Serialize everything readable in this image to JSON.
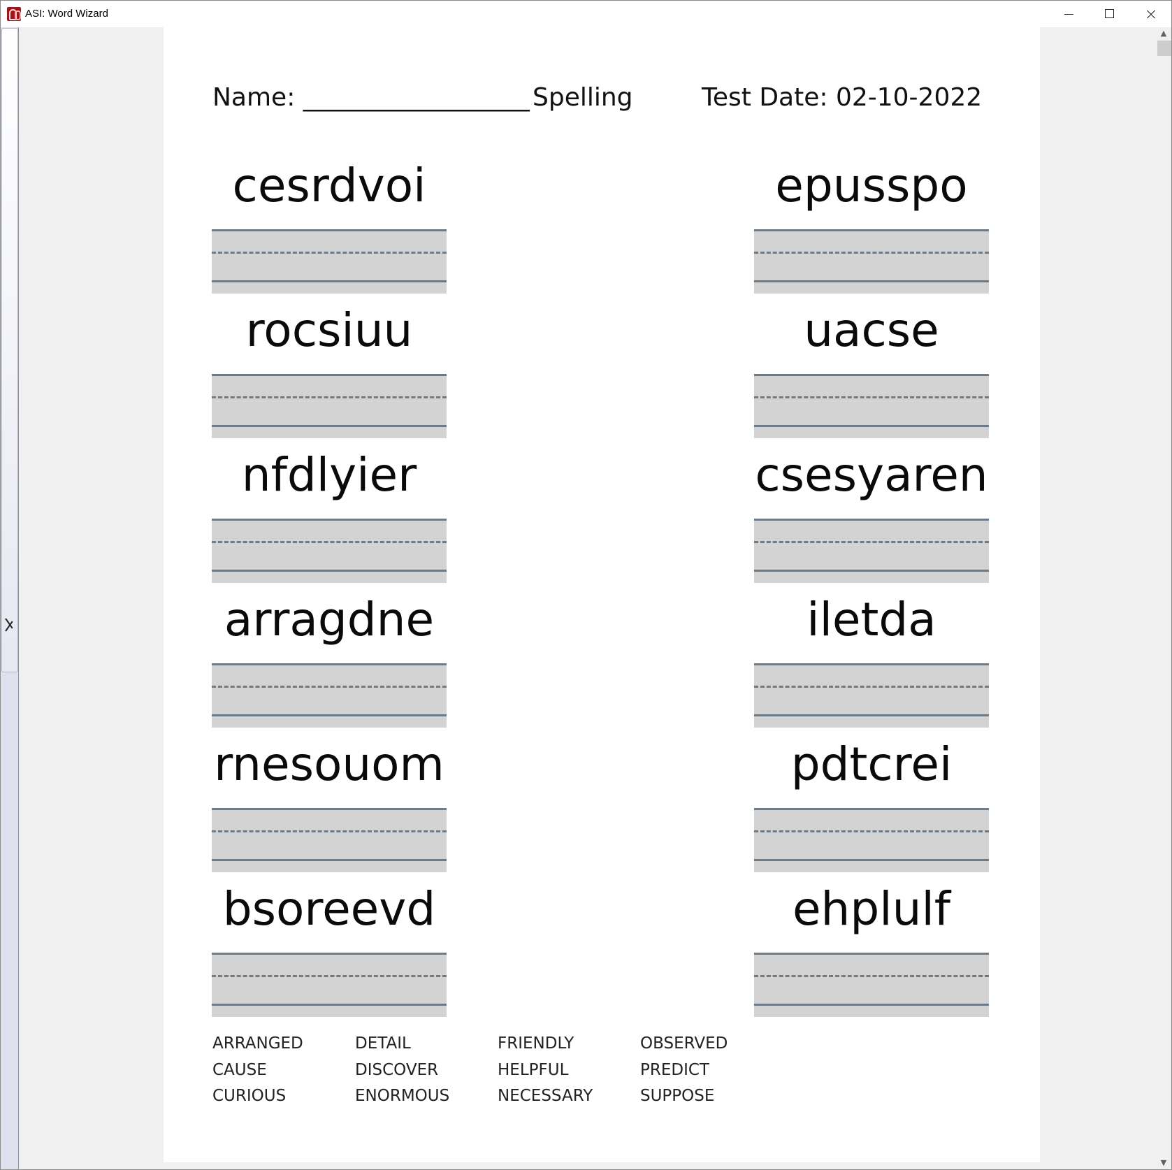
{
  "window": {
    "title": "ASI: Word Wizard",
    "controls": [
      "minimize",
      "maximize",
      "close"
    ]
  },
  "worksheet": {
    "name_label": "Name: __________________",
    "subject": "Spelling",
    "test_date": "Test Date: 02-10-2022",
    "left_words": [
      "cesrdvoi",
      "rocsiuu",
      "nfdlyier",
      "arragdne",
      "rnesouom",
      "bsoreevd"
    ],
    "right_words": [
      "epusspo",
      "uacse",
      "csesyaren",
      "iletda",
      "pdtcrei",
      "ehplulf"
    ],
    "word_bank": [
      [
        "ARRANGED",
        "CAUSE",
        "CURIOUS"
      ],
      [
        "DETAIL",
        "DISCOVER",
        "ENORMOUS"
      ],
      [
        "FRIENDLY",
        "HELPFUL",
        "NECESSARY"
      ],
      [
        "OBSERVED",
        "PREDICT",
        "SUPPOSE"
      ]
    ]
  },
  "scrollbar": {
    "up_arrow": "▲",
    "down_arrow": "▼"
  },
  "colors": {
    "line_color": "#6e7a86",
    "writing_band": "#d3d3d3",
    "page_background": "#ffffff",
    "viewer_background": "#f0f0f0"
  }
}
